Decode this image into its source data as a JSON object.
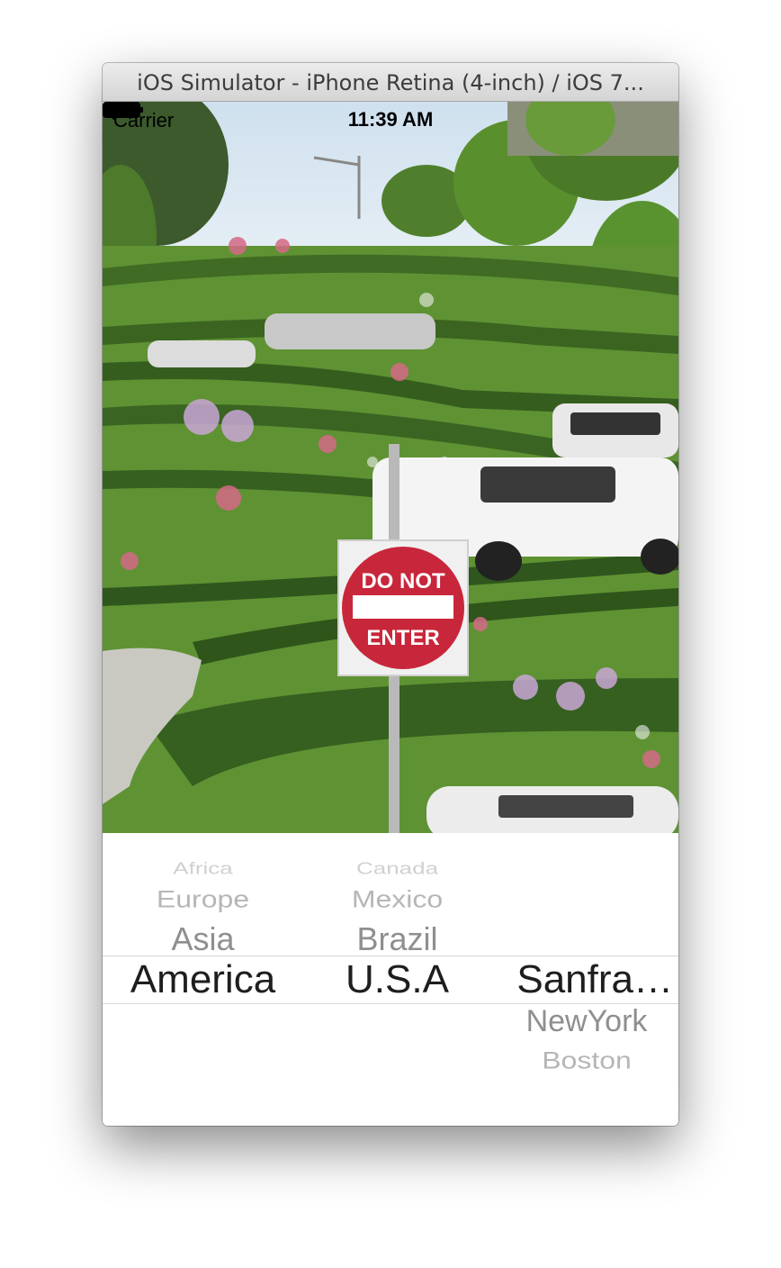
{
  "window": {
    "title": "iOS Simulator - iPhone Retina (4-inch) / iOS 7..."
  },
  "status_bar": {
    "carrier": "Carrier",
    "time": "11:39 AM",
    "wifi_icon": "wifi-icon",
    "battery_icon": "battery-icon"
  },
  "photo": {
    "sign_line1": "DO NOT",
    "sign_line2": "ENTER"
  },
  "picker": {
    "columns": [
      {
        "above": [
          "Africa",
          "Europe",
          "Asia"
        ],
        "selected": "America",
        "below": []
      },
      {
        "above": [
          "Canada",
          "Mexico",
          "Brazil"
        ],
        "selected": "U.S.A",
        "below": []
      },
      {
        "above": [],
        "selected": "Sanfra…",
        "below": [
          "NewYork",
          "Boston"
        ]
      }
    ]
  }
}
